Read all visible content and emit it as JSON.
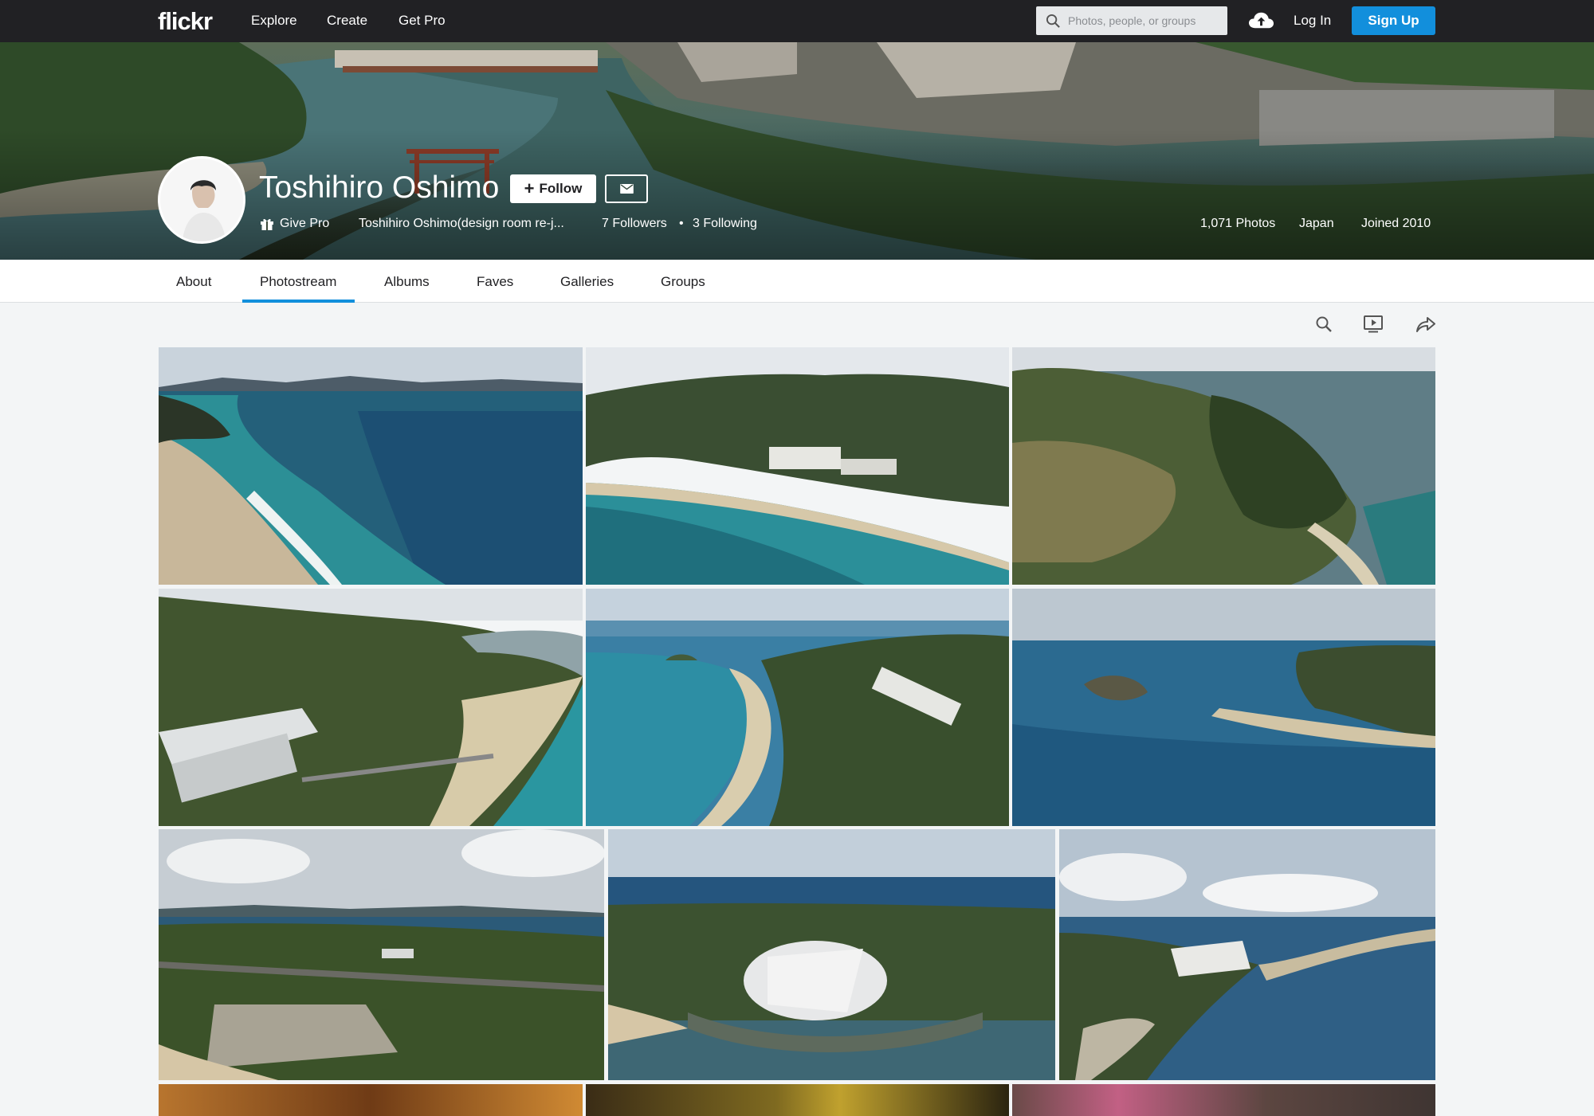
{
  "nav": {
    "logo": "flickr",
    "links": [
      "Explore",
      "Create",
      "Get Pro"
    ],
    "search_placeholder": "Photos, people, or groups",
    "login": "Log In",
    "signup": "Sign Up",
    "upload_icon": "cloud-upload-icon"
  },
  "profile": {
    "name": "Toshihiro Oshimo",
    "follow_label": "Follow",
    "give_pro": "Give Pro",
    "display_name": "Toshihiro Oshimo(design room re-j...",
    "followers": "7 Followers",
    "following": "3 Following",
    "separator": "•",
    "photos": "1,071 Photos",
    "location": "Japan",
    "joined": "Joined 2010"
  },
  "tabs": [
    "About",
    "Photostream",
    "Albums",
    "Faves",
    "Galleries",
    "Groups"
  ],
  "active_tab": "Photostream",
  "tools": [
    "search-icon",
    "slideshow-icon",
    "share-icon"
  ],
  "colors": {
    "nav_bg": "#212124",
    "accent": "#128fdc",
    "page_bg": "#f3f5f6"
  }
}
